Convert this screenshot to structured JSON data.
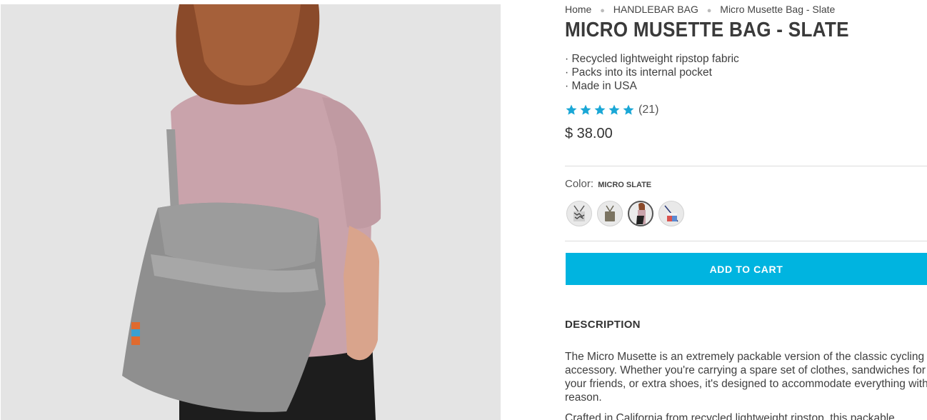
{
  "breadcrumb": {
    "items": [
      "Home",
      "HANDLEBAR BAG",
      "Micro Musette Bag - Slate"
    ]
  },
  "product": {
    "title": "MICRO MUSETTE BAG - SLATE",
    "features": [
      "· Recycled lightweight ripstop fabric",
      "· Packs into its internal pocket",
      "· Made in USA"
    ],
    "rating": {
      "stars": 5,
      "max": 5,
      "count_text": "(21)"
    },
    "price": "$ 38.00",
    "color_label": "Color:",
    "color_value": "Micro Slate",
    "swatches": [
      {
        "name": "patterned",
        "selected": false
      },
      {
        "name": "olive",
        "selected": false
      },
      {
        "name": "slate",
        "selected": true
      },
      {
        "name": "red-white-blue",
        "selected": false
      }
    ],
    "add_to_cart": "ADD TO CART"
  },
  "description": {
    "heading": "DESCRIPTION",
    "paragraphs": [
      "The Micro Musette is an extremely packable version of the classic cycling accessory. Whether you're carrying a spare set of clothes, sandwiches for your friends, or extra shoes, it's designed to accommodate everything with reason.",
      "Crafted in California from recycled lightweight ripstop, this packable"
    ]
  },
  "colors": {
    "accent": "#00b4e0",
    "star": "#1aa7d6",
    "photo_bg": "#e4e4e4"
  }
}
